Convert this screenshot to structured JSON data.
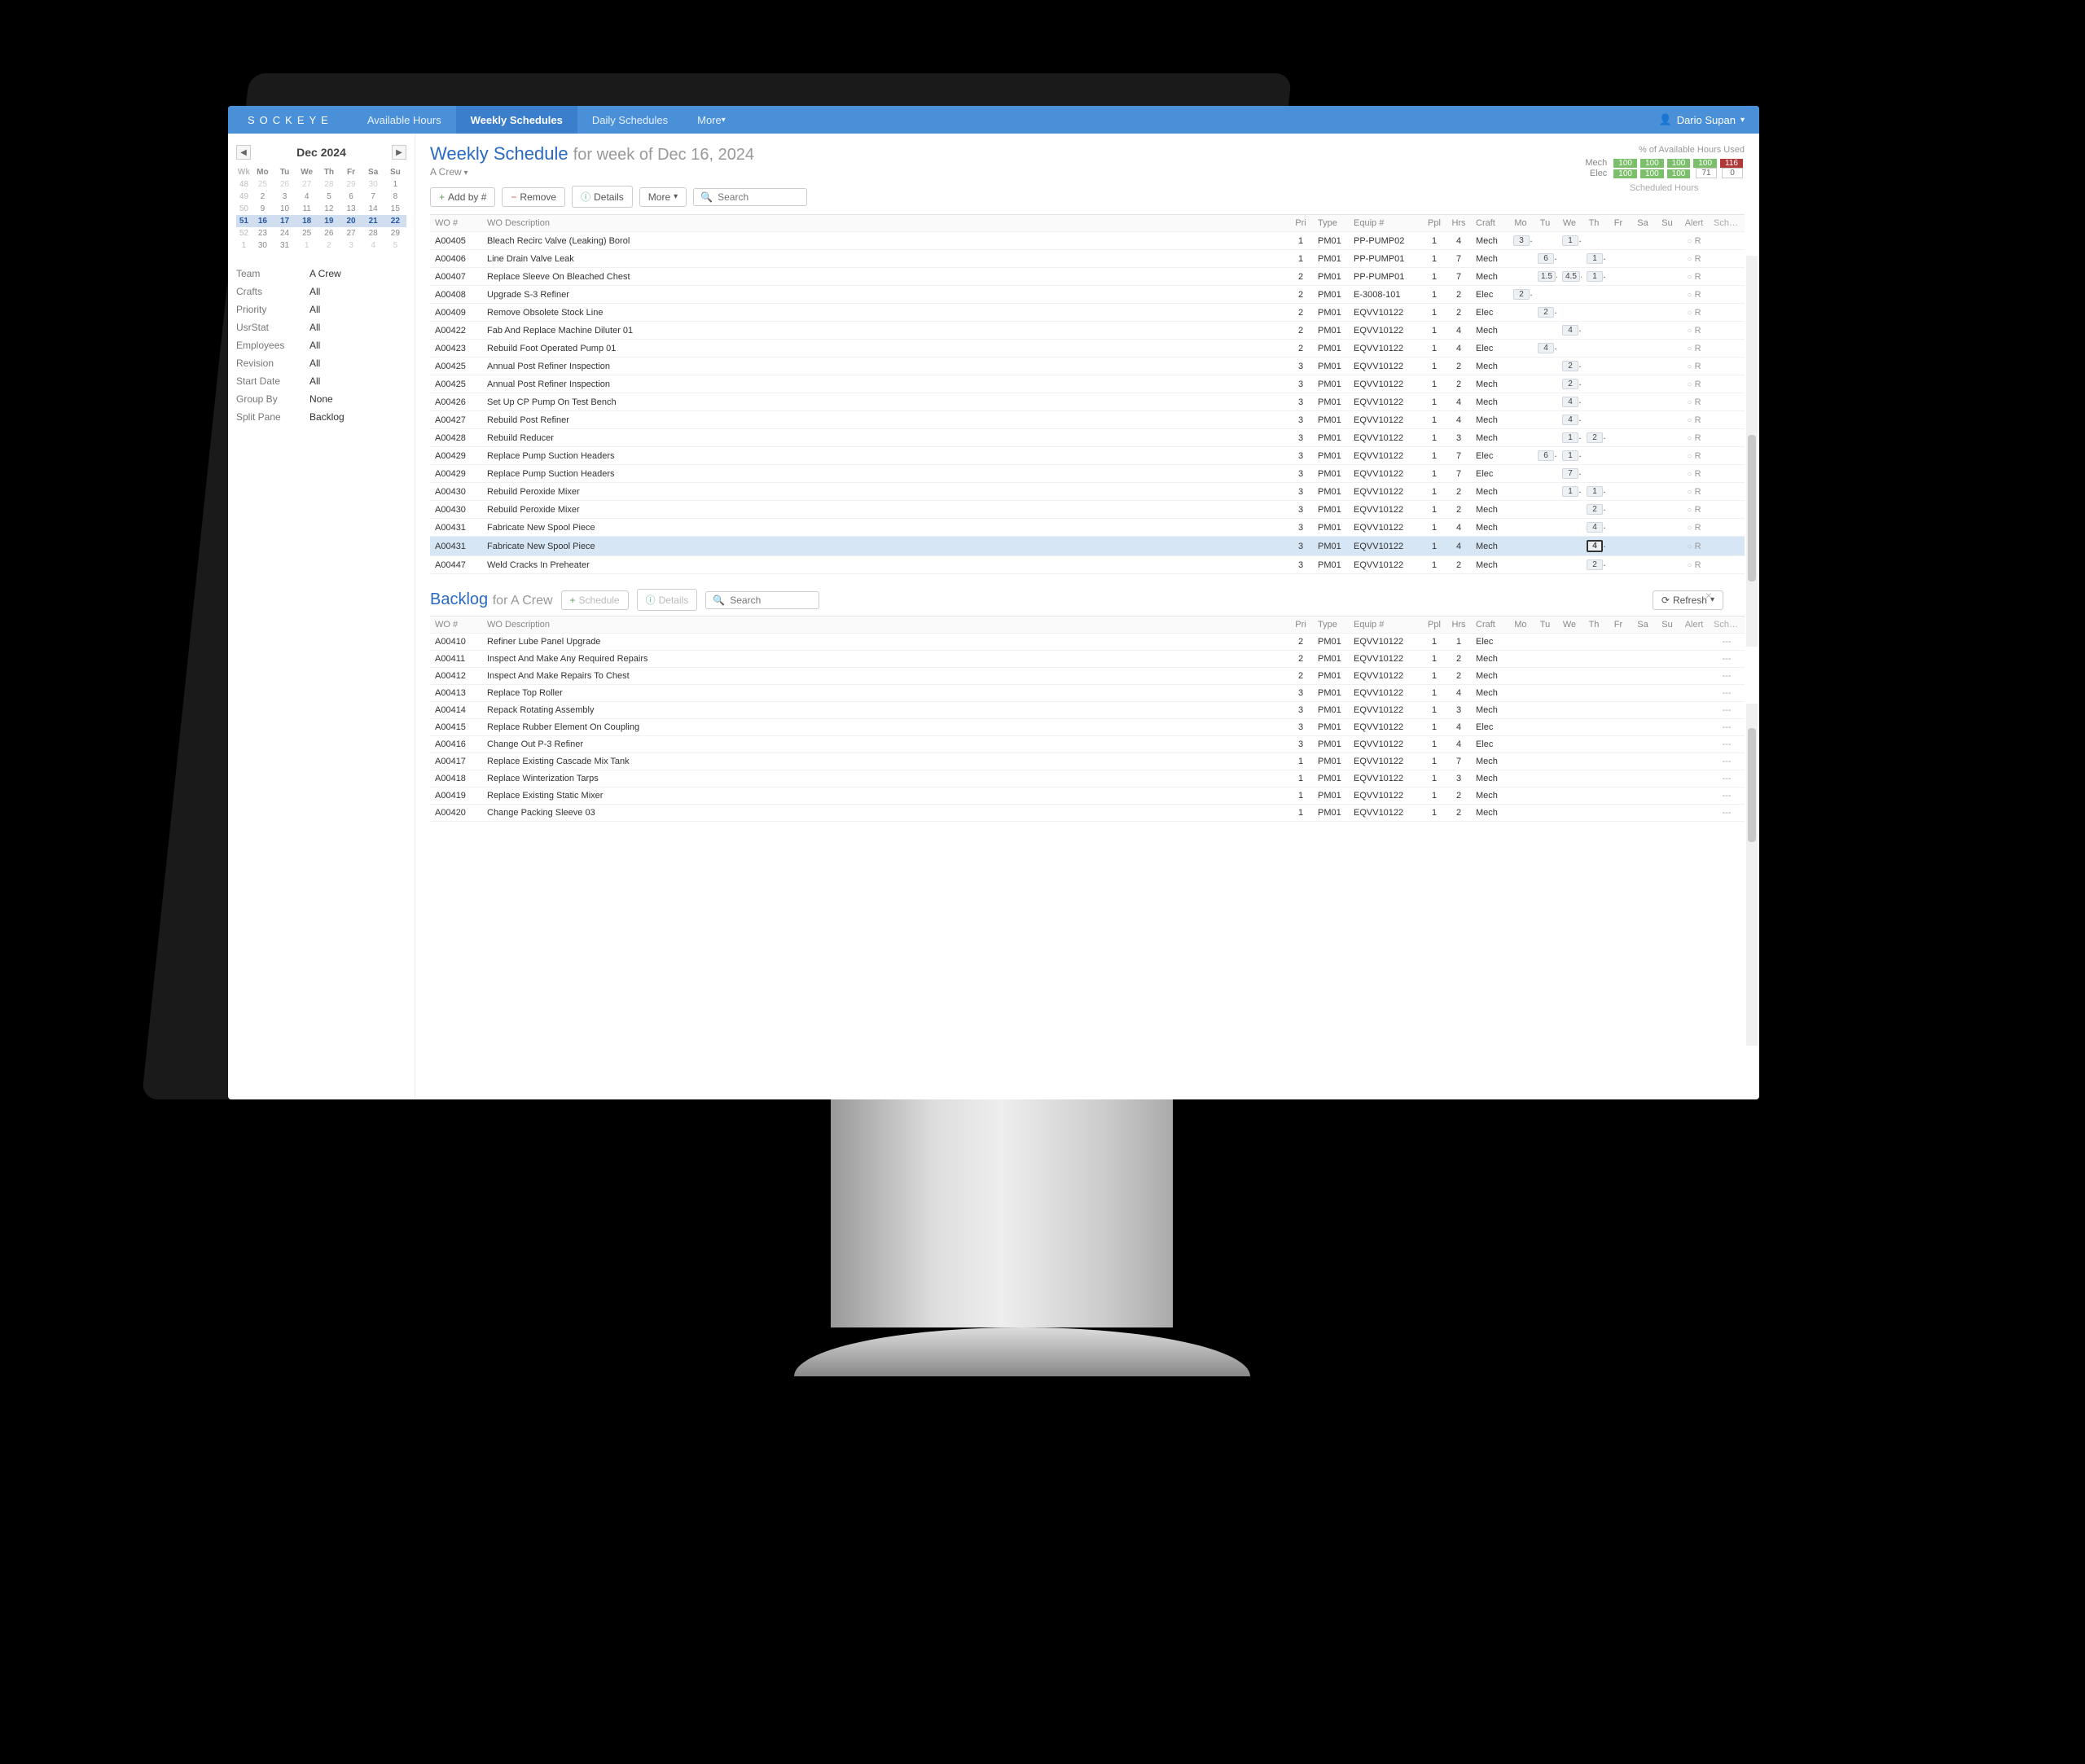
{
  "brand": "SOCKEYE",
  "nav": {
    "available": "Available Hours",
    "weekly": "Weekly Schedules",
    "daily": "Daily Schedules",
    "more": "More"
  },
  "user": "Dario Supan",
  "calendar": {
    "label": "Dec 2024",
    "dow": [
      "Wk",
      "Mo",
      "Tu",
      "We",
      "Th",
      "Fr",
      "Sa",
      "Su"
    ],
    "rows": [
      {
        "wk": "48",
        "d": [
          "25",
          "26",
          "27",
          "28",
          "29",
          "30",
          "1"
        ],
        "dim": [
          0,
          1,
          2,
          3,
          4,
          5
        ]
      },
      {
        "wk": "49",
        "d": [
          "2",
          "3",
          "4",
          "5",
          "6",
          "7",
          "8"
        ]
      },
      {
        "wk": "50",
        "d": [
          "9",
          "10",
          "11",
          "12",
          "13",
          "14",
          "15"
        ]
      },
      {
        "wk": "51",
        "d": [
          "16",
          "17",
          "18",
          "19",
          "20",
          "21",
          "22"
        ],
        "selected": true
      },
      {
        "wk": "52",
        "d": [
          "23",
          "24",
          "25",
          "26",
          "27",
          "28",
          "29"
        ]
      },
      {
        "wk": "1",
        "d": [
          "30",
          "31",
          "1",
          "2",
          "3",
          "4",
          "5"
        ],
        "dim": [
          2,
          3,
          4,
          5,
          6
        ]
      }
    ]
  },
  "filters": [
    {
      "k": "Team",
      "v": "A Crew"
    },
    {
      "k": "Crafts",
      "v": "All"
    },
    {
      "k": "Priority",
      "v": "All"
    },
    {
      "k": "UsrStat",
      "v": "All"
    },
    {
      "k": "Employees",
      "v": "All"
    },
    {
      "k": "Revision",
      "v": "All"
    },
    {
      "k": "Start Date",
      "v": "All"
    },
    {
      "k": "Group By",
      "v": "None"
    },
    {
      "k": "Split Pane",
      "v": "Backlog"
    }
  ],
  "page": {
    "title": "Weekly Schedule",
    "subtitle": "for week of Dec 16, 2024",
    "crew": "A Crew"
  },
  "toolbar": {
    "add": "Add by #",
    "remove": "Remove",
    "details": "Details",
    "more": "More",
    "search": "Search"
  },
  "avail": {
    "title": "% of Available Hours Used",
    "scheduled_title": "Scheduled Hours",
    "rows": [
      {
        "label": "Mech",
        "cells": [
          {
            "v": "100",
            "c": "g"
          },
          {
            "v": "100",
            "c": "g"
          },
          {
            "v": "100",
            "c": "g"
          },
          {
            "v": "100",
            "c": "g"
          },
          {
            "v": "116",
            "c": "r"
          }
        ]
      },
      {
        "label": "Elec",
        "cells": [
          {
            "v": "100",
            "c": "g"
          },
          {
            "v": "100",
            "c": "g"
          },
          {
            "v": "100",
            "c": "g"
          },
          {
            "v": "71",
            "c": "w"
          },
          {
            "v": "0",
            "c": "w"
          }
        ]
      }
    ]
  },
  "columns": [
    "WO #",
    "WO Description",
    "Pri",
    "Type",
    "Equip #",
    "Ppl",
    "Hrs",
    "Craft",
    "Mo",
    "Tu",
    "We",
    "Th",
    "Fr",
    "Sa",
    "Su",
    "Alert",
    "Sched Comp"
  ],
  "schedule": [
    {
      "wo": "A00405",
      "desc": "Bleach Recirc Valve (Leaking) Borol",
      "pri": "1",
      "type": "PM01",
      "eq": "PP-PUMP02",
      "ppl": "1",
      "hrs": "4",
      "craft": "Mech",
      "days": {
        "Mo": "3",
        "We": "1"
      }
    },
    {
      "wo": "A00406",
      "desc": "Line Drain Valve Leak",
      "pri": "1",
      "type": "PM01",
      "eq": "PP-PUMP01",
      "ppl": "1",
      "hrs": "7",
      "craft": "Mech",
      "days": {
        "Tu": "6",
        "Th": "1"
      }
    },
    {
      "wo": "A00407",
      "desc": "Replace Sleeve On Bleached Chest",
      "pri": "2",
      "type": "PM01",
      "eq": "PP-PUMP01",
      "ppl": "1",
      "hrs": "7",
      "craft": "Mech",
      "days": {
        "Tu": "1.5",
        "We": "4.5",
        "Th": "1"
      }
    },
    {
      "wo": "A00408",
      "desc": "Upgrade S-3 Refiner",
      "pri": "2",
      "type": "PM01",
      "eq": "E-3008-101",
      "ppl": "1",
      "hrs": "2",
      "craft": "Elec",
      "days": {
        "Mo": "2"
      }
    },
    {
      "wo": "A00409",
      "desc": "Remove Obsolete Stock Line",
      "pri": "2",
      "type": "PM01",
      "eq": "EQVV10122",
      "ppl": "1",
      "hrs": "2",
      "craft": "Elec",
      "days": {
        "Tu": "2"
      }
    },
    {
      "wo": "A00422",
      "desc": "Fab And Replace Machine Diluter 01",
      "pri": "2",
      "type": "PM01",
      "eq": "EQVV10122",
      "ppl": "1",
      "hrs": "4",
      "craft": "Mech",
      "days": {
        "We": "4"
      }
    },
    {
      "wo": "A00423",
      "desc": "Rebuild Foot Operated Pump 01",
      "pri": "2",
      "type": "PM01",
      "eq": "EQVV10122",
      "ppl": "1",
      "hrs": "4",
      "craft": "Elec",
      "days": {
        "Tu": "4"
      }
    },
    {
      "wo": "A00425",
      "desc": "Annual Post Refiner Inspection",
      "pri": "3",
      "type": "PM01",
      "eq": "EQVV10122",
      "ppl": "1",
      "hrs": "2",
      "craft": "Mech",
      "days": {
        "We": "2"
      }
    },
    {
      "wo": "A00425",
      "desc": "Annual Post Refiner Inspection",
      "pri": "3",
      "type": "PM01",
      "eq": "EQVV10122",
      "ppl": "1",
      "hrs": "2",
      "craft": "Mech",
      "days": {
        "We": "2"
      }
    },
    {
      "wo": "A00426",
      "desc": "Set Up CP Pump On Test Bench",
      "pri": "3",
      "type": "PM01",
      "eq": "EQVV10122",
      "ppl": "1",
      "hrs": "4",
      "craft": "Mech",
      "days": {
        "We": "4"
      }
    },
    {
      "wo": "A00427",
      "desc": "Rebuild Post Refiner",
      "pri": "3",
      "type": "PM01",
      "eq": "EQVV10122",
      "ppl": "1",
      "hrs": "4",
      "craft": "Mech",
      "days": {
        "We": "4"
      }
    },
    {
      "wo": "A00428",
      "desc": "Rebuild Reducer",
      "pri": "3",
      "type": "PM01",
      "eq": "EQVV10122",
      "ppl": "1",
      "hrs": "3",
      "craft": "Mech",
      "days": {
        "We": "1",
        "Th": "2"
      }
    },
    {
      "wo": "A00429",
      "desc": "Replace Pump Suction Headers",
      "pri": "3",
      "type": "PM01",
      "eq": "EQVV10122",
      "ppl": "1",
      "hrs": "7",
      "craft": "Elec",
      "days": {
        "Tu": "6",
        "We": "1"
      }
    },
    {
      "wo": "A00429",
      "desc": "Replace Pump Suction Headers",
      "pri": "3",
      "type": "PM01",
      "eq": "EQVV10122",
      "ppl": "1",
      "hrs": "7",
      "craft": "Elec",
      "days": {
        "We": "7"
      }
    },
    {
      "wo": "A00430",
      "desc": "Rebuild Peroxide Mixer",
      "pri": "3",
      "type": "PM01",
      "eq": "EQVV10122",
      "ppl": "1",
      "hrs": "2",
      "craft": "Mech",
      "days": {
        "We": "1",
        "Th": "1"
      }
    },
    {
      "wo": "A00430",
      "desc": "Rebuild Peroxide Mixer",
      "pri": "3",
      "type": "PM01",
      "eq": "EQVV10122",
      "ppl": "1",
      "hrs": "2",
      "craft": "Mech",
      "days": {
        "Th": "2"
      }
    },
    {
      "wo": "A00431",
      "desc": "Fabricate New Spool Piece",
      "pri": "3",
      "type": "PM01",
      "eq": "EQVV10122",
      "ppl": "1",
      "hrs": "4",
      "craft": "Mech",
      "days": {
        "Th": "4"
      }
    },
    {
      "wo": "A00431",
      "desc": "Fabricate New Spool Piece",
      "pri": "3",
      "type": "PM01",
      "eq": "EQVV10122",
      "ppl": "1",
      "hrs": "4",
      "craft": "Mech",
      "days": {
        "Th": "4"
      },
      "selected": true
    },
    {
      "wo": "A00447",
      "desc": "Weld Cracks In Preheater",
      "pri": "3",
      "type": "PM01",
      "eq": "EQVV10122",
      "ppl": "1",
      "hrs": "2",
      "craft": "Mech",
      "days": {
        "Th": "2"
      }
    }
  ],
  "backlog_title": "Backlog",
  "backlog_sub": "for A Crew",
  "backlog_toolbar": {
    "schedule": "Schedule",
    "details": "Details",
    "search": "Search",
    "refresh": "Refresh"
  },
  "backlog": [
    {
      "wo": "A00410",
      "desc": "Refiner Lube Panel Upgrade",
      "pri": "2",
      "type": "PM01",
      "eq": "EQVV10122",
      "ppl": "1",
      "hrs": "1",
      "craft": "Elec"
    },
    {
      "wo": "A00411",
      "desc": "Inspect And Make Any Required Repairs",
      "pri": "2",
      "type": "PM01",
      "eq": "EQVV10122",
      "ppl": "1",
      "hrs": "2",
      "craft": "Mech"
    },
    {
      "wo": "A00412",
      "desc": "Inspect And Make Repairs To Chest",
      "pri": "2",
      "type": "PM01",
      "eq": "EQVV10122",
      "ppl": "1",
      "hrs": "2",
      "craft": "Mech"
    },
    {
      "wo": "A00413",
      "desc": "Replace Top Roller",
      "pri": "3",
      "type": "PM01",
      "eq": "EQVV10122",
      "ppl": "1",
      "hrs": "4",
      "craft": "Mech"
    },
    {
      "wo": "A00414",
      "desc": "Repack Rotating Assembly",
      "pri": "3",
      "type": "PM01",
      "eq": "EQVV10122",
      "ppl": "1",
      "hrs": "3",
      "craft": "Mech"
    },
    {
      "wo": "A00415",
      "desc": "Replace Rubber Element On Coupling",
      "pri": "3",
      "type": "PM01",
      "eq": "EQVV10122",
      "ppl": "1",
      "hrs": "4",
      "craft": "Elec"
    },
    {
      "wo": "A00416",
      "desc": "Change Out P-3 Refiner",
      "pri": "3",
      "type": "PM01",
      "eq": "EQVV10122",
      "ppl": "1",
      "hrs": "4",
      "craft": "Elec"
    },
    {
      "wo": "A00417",
      "desc": "Replace Existing Cascade Mix Tank",
      "pri": "1",
      "type": "PM01",
      "eq": "EQVV10122",
      "ppl": "1",
      "hrs": "7",
      "craft": "Mech"
    },
    {
      "wo": "A00418",
      "desc": "Replace Winterization Tarps",
      "pri": "1",
      "type": "PM01",
      "eq": "EQVV10122",
      "ppl": "1",
      "hrs": "3",
      "craft": "Mech"
    },
    {
      "wo": "A00419",
      "desc": "Replace Existing Static Mixer",
      "pri": "1",
      "type": "PM01",
      "eq": "EQVV10122",
      "ppl": "1",
      "hrs": "2",
      "craft": "Mech"
    },
    {
      "wo": "A00420",
      "desc": "Change Packing Sleeve 03",
      "pri": "1",
      "type": "PM01",
      "eq": "EQVV10122",
      "ppl": "1",
      "hrs": "2",
      "craft": "Mech"
    }
  ],
  "day_keys": [
    "Mo",
    "Tu",
    "We",
    "Th",
    "Fr",
    "Sa",
    "Su"
  ],
  "alert_text": "R",
  "sched_dash": "---"
}
